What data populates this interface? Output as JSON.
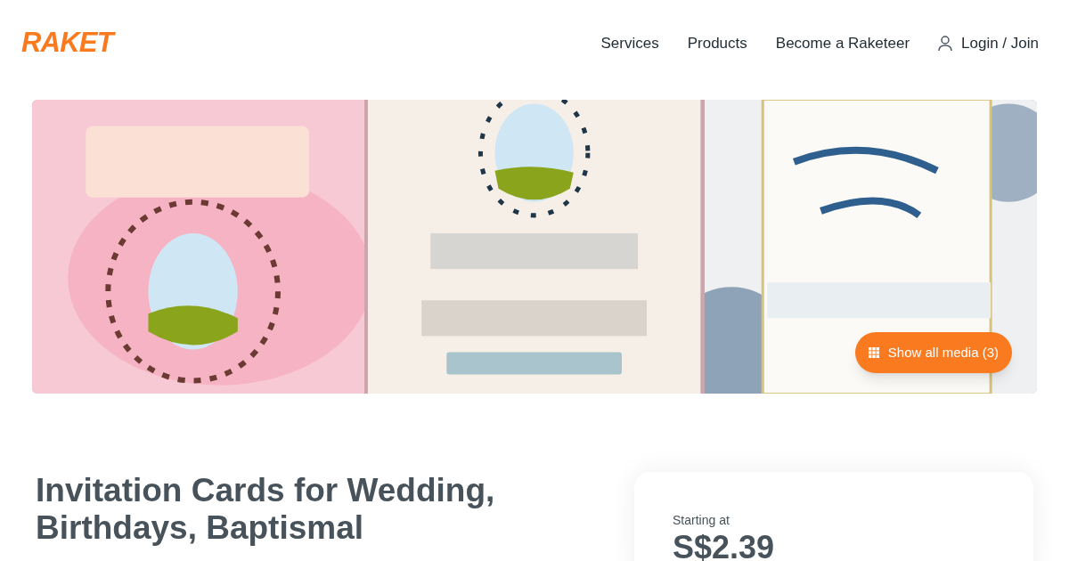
{
  "logo": "RAKET",
  "nav": [
    {
      "label": "Services"
    },
    {
      "label": "Products"
    },
    {
      "label": "Become a Raketeer"
    },
    {
      "label": "Login / Join",
      "kind": "account"
    }
  ],
  "gallery": {
    "button": "Show all media (3)"
  },
  "title": "Invitation Cards for Wedding, Birthdays, Baptismal",
  "price_card": {
    "label": "Starting at",
    "price": "S$2.39"
  }
}
